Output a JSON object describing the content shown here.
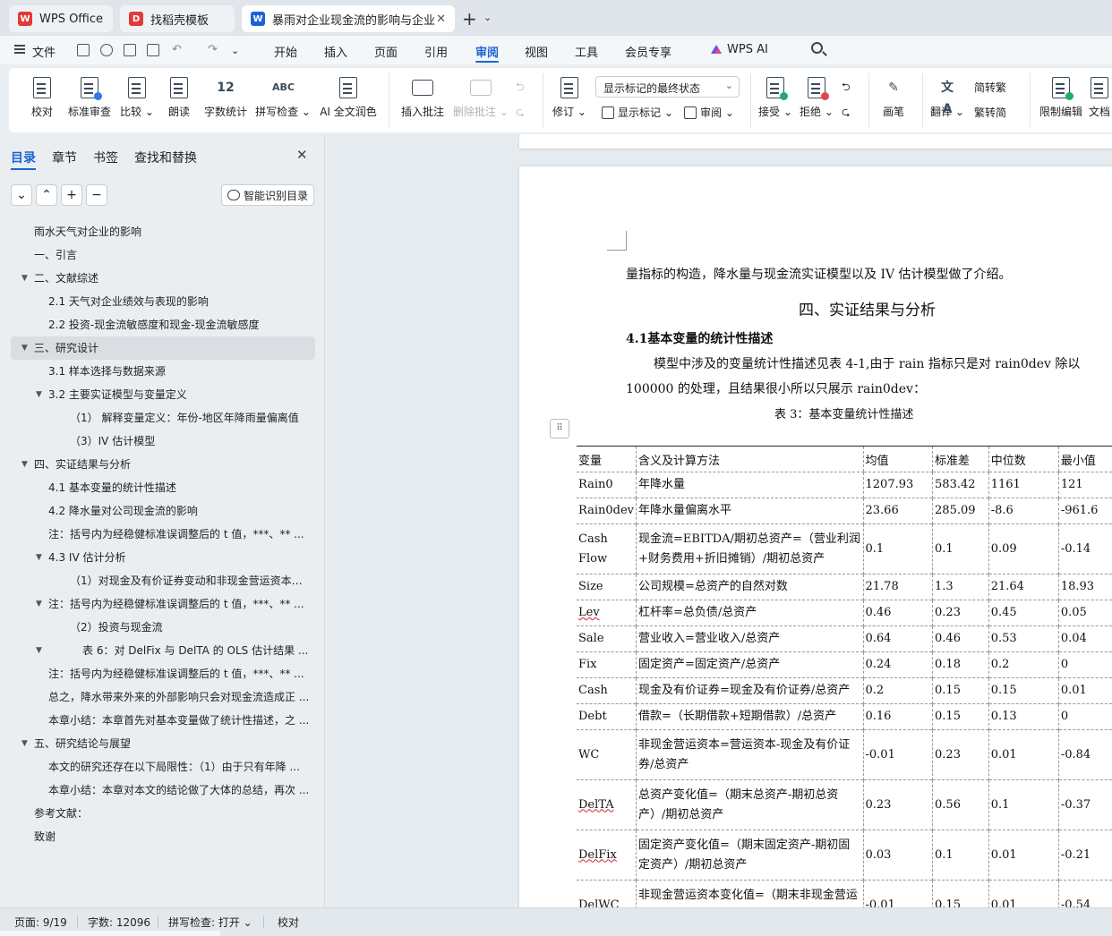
{
  "tabs": [
    {
      "label": "WPS Office",
      "icon": "wps-logo-icon",
      "color": "#e23a3a"
    },
    {
      "label": "找稻壳模板",
      "icon": "docer-icon",
      "color": "#e23a3a"
    },
    {
      "label": "暴雨对企业现金流的影响与企业",
      "icon": "word-doc-icon",
      "color": "#1a64d6"
    }
  ],
  "menu": {
    "file": "文件",
    "items": [
      "开始",
      "插入",
      "页面",
      "引用",
      "审阅",
      "视图",
      "工具",
      "会员专享",
      "WPS AI"
    ],
    "active": "审阅"
  },
  "ribbon": {
    "proofread": "校对",
    "standard_review": "标准审查",
    "compare": "比较",
    "read_aloud": "朗读",
    "word_count": "字数统计",
    "spell_check": "拼写检查",
    "ai_polish": "AI 全文润色",
    "insert_comment": "插入批注",
    "delete_comment": "删除批注",
    "revise": "修订",
    "display_mode": "显示标记的最终状态",
    "show_markup": "显示标记",
    "review": "审阅",
    "accept": "接受",
    "reject": "拒绝",
    "pen": "画笔",
    "translate": "翻译",
    "to_traditional": "简转繁",
    "to_simplified": "繁转简",
    "restrict_edit": "限制编辑",
    "doc_permission": "文档"
  },
  "left_panel": {
    "tabs": [
      "目录",
      "章节",
      "书签",
      "查找和替换"
    ],
    "active_tab": "目录",
    "smart_toc": "智能识别目录",
    "toc": [
      {
        "label": "雨水天气对企业的影响",
        "level": 0,
        "toggle": ""
      },
      {
        "label": "一、引言",
        "level": 0,
        "toggle": ""
      },
      {
        "label": "二、文献综述",
        "level": 0,
        "toggle": "▼"
      },
      {
        "label": "2.1 天气对企业绩效与表现的影响",
        "level": 1,
        "toggle": ""
      },
      {
        "label": "2.2 投资-现金流敏感度和现金-现金流敏感度",
        "level": 1,
        "toggle": ""
      },
      {
        "label": "三、研究设计",
        "level": 0,
        "toggle": "▼",
        "selected": true
      },
      {
        "label": "3.1  样本选择与数据来源",
        "level": 1,
        "toggle": ""
      },
      {
        "label": "3.2  主要实证模型与变量定义",
        "level": 1,
        "toggle": "▼"
      },
      {
        "label": "（1）  解释变量定义：年份-地区年降雨量偏离值",
        "level": 2,
        "toggle": ""
      },
      {
        "label": "（3）IV 估计模型",
        "level": 2,
        "toggle": ""
      },
      {
        "label": "四、实证结果与分析",
        "level": 0,
        "toggle": "▼"
      },
      {
        "label": "4.1 基本变量的统计性描述",
        "level": 1,
        "toggle": ""
      },
      {
        "label": "4.2 降水量对公司现金流的影响",
        "level": 1,
        "toggle": ""
      },
      {
        "label": "注：括号内为经稳健标准误调整后的 t 值，***、** ...",
        "level": 1,
        "toggle": ""
      },
      {
        "label": "4.3 IV 估计分析",
        "level": 1,
        "toggle": "▼"
      },
      {
        "label": "（1）对现金及有价证券变动和非现金营运资本变 ...",
        "level": 2,
        "toggle": ""
      },
      {
        "label": "注：括号内为经稳健标准误调整后的 t 值，***、** ...",
        "level": 1,
        "toggle": "▼"
      },
      {
        "label": "（2）投资与现金流",
        "level": 2,
        "toggle": ""
      },
      {
        "label": "表 6：对 DelFix 与 DelTA 的 OLS 估计结果 ...",
        "level": 3,
        "toggle": "▼"
      },
      {
        "label": "注：括号内为经稳健标准误调整后的 t 值，***、** ...",
        "level": 1,
        "toggle": ""
      },
      {
        "label": "总之，降水带来外来的外部影响只会对现金流造成正 ...",
        "level": 1,
        "toggle": ""
      },
      {
        "label": "本章小结：本章首先对基本变量做了统计性描述，之 ...",
        "level": 1,
        "toggle": ""
      },
      {
        "label": "五、研究结论与展望",
        "level": 0,
        "toggle": "▼"
      },
      {
        "label": "本文的研究还存在以下局限性：（1）由于只有年降 ...",
        "level": 1,
        "toggle": ""
      },
      {
        "label": "本章小结：本章对本文的结论做了大体的总结，再次 ...",
        "level": 1,
        "toggle": ""
      },
      {
        "label": "参考文献：",
        "level": 0,
        "toggle": ""
      },
      {
        "label": "致谢",
        "level": 0,
        "toggle": ""
      }
    ]
  },
  "document": {
    "line1": "量指标的构造，降水量与现金流实证模型以及 IV 估计模型做了介绍。",
    "section_title": "四、实证结果与分析",
    "subsection_title": "4.1基本变量的统计性描述",
    "para_line1": "模型中涉及的变量统计性描述见表 4-1,由于 rain 指标只是对 rain0dev 除以",
    "para_line2": "100000 的处理，且结果很小所以只展示 rain0dev：",
    "table_caption": "表 3：基本变量统计性描述",
    "table": {
      "headers": [
        "变量",
        "含义及计算方法",
        "均值",
        "标准差",
        "中位数",
        "最小值"
      ],
      "rows": [
        {
          "cells": [
            "Rain0",
            "年降水量",
            "1207.93",
            "583.42",
            "1161",
            "121"
          ]
        },
        {
          "cells": [
            "Rain0dev",
            "年降水量偏离水平",
            "23.66",
            "285.09",
            "-8.6",
            "-961.6"
          ]
        },
        {
          "cells": [
            "Cash Flow",
            "现金流=EBITDA/期初总资产=（营业利润+财务费用+折旧摊销）/期初总资产",
            "0.1",
            "0.1",
            "0.09",
            "-0.14"
          ],
          "tall": true
        },
        {
          "cells": [
            "Size",
            "公司规模=总资产的自然对数",
            "21.78",
            "1.3",
            "21.64",
            "18.93"
          ]
        },
        {
          "cells": [
            "Lev",
            "杠杆率=总负债/总资产",
            "0.46",
            "0.23",
            "0.45",
            "0.05"
          ],
          "squiggle": true
        },
        {
          "cells": [
            "Sale",
            "营业收入=营业收入/总资产",
            "0.64",
            "0.46",
            "0.53",
            "0.04"
          ]
        },
        {
          "cells": [
            "Fix",
            "固定资产=固定资产/总资产",
            "0.24",
            "0.18",
            "0.2",
            "0"
          ]
        },
        {
          "cells": [
            "Cash",
            "现金及有价证券=现金及有价证券/总资产",
            "0.2",
            "0.15",
            "0.15",
            "0.01"
          ]
        },
        {
          "cells": [
            "Debt",
            "借款=（长期借款+短期借款）/总资产",
            "0.16",
            "0.15",
            "0.13",
            "0"
          ]
        },
        {
          "cells": [
            "WC",
            "非现金营运资本=营运资本-现金及有价证券/总资产",
            "-0.01",
            "0.23",
            "0.01",
            "-0.84"
          ],
          "tall": true
        },
        {
          "cells": [
            "DelTA",
            "总资产变化值=（期末总资产-期初总资产）/期初总资产",
            "0.23",
            "0.56",
            "0.1",
            "-0.37"
          ],
          "tall": true,
          "squiggle": true
        },
        {
          "cells": [
            "DelFix",
            "固定资产变化值=（期末固定资产-期初固定资产）/期初总资产",
            "0.03",
            "0.1",
            "0.01",
            "-0.21"
          ],
          "tall": true,
          "squiggle": true
        },
        {
          "cells": [
            "DelWC",
            "非现金营运资本变化值=（期末非现金营运资本-期初非现金营运资本）/期初总资产",
            "-0.01",
            "0.15",
            "0.01",
            "-0.54"
          ],
          "tall": true,
          "squiggle": true
        }
      ]
    }
  },
  "status": {
    "page": "页面: 9/19",
    "words": "字数: 12096",
    "spell": "拼写检查: 打开",
    "proof": "校对"
  }
}
